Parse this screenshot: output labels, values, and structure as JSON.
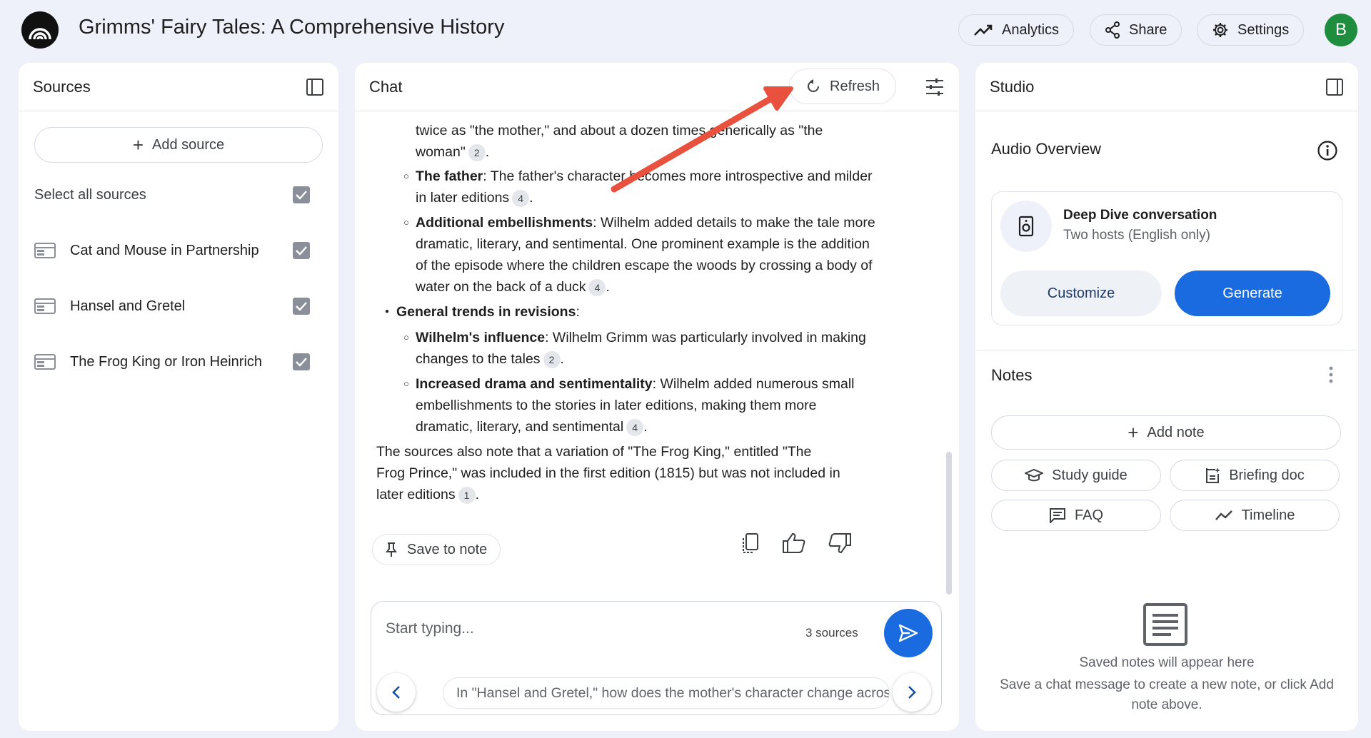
{
  "header": {
    "title": "Grimms' Fairy Tales: A Comprehensive History",
    "analytics_label": "Analytics",
    "share_label": "Share",
    "settings_label": "Settings",
    "avatar_initial": "B"
  },
  "sources": {
    "title": "Sources",
    "add_source_label": "Add source",
    "select_all_label": "Select all sources",
    "items": [
      {
        "label": "Cat and Mouse in Partnership",
        "checked": true
      },
      {
        "label": "Hansel and Gretel",
        "checked": true
      },
      {
        "label": "The Frog King or Iron Heinrich",
        "checked": true
      }
    ]
  },
  "chat": {
    "title": "Chat",
    "refresh_label": "Refresh",
    "intro_text": "twice as \"the mother,\" and about a dozen times generically as \"the woman\"",
    "intro_cite": "2",
    "items": [
      {
        "bold": "The father",
        "text": ": The father's character becomes more introspective and milder in later editions",
        "cite": "4"
      },
      {
        "bold": "Additional embellishments",
        "text": ": Wilhelm added details to make the tale more dramatic, literary, and sentimental. One prominent example is the addition of the episode where the children escape the woods by crossing a body of water on the back of a duck",
        "cite": "4"
      }
    ],
    "bullet_heading": "General trends in revisions",
    "bullet_items": [
      {
        "bold": "Wilhelm's influence",
        "text": ": Wilhelm Grimm was particularly involved in making changes to the tales",
        "cite": "2"
      },
      {
        "bold": "Increased drama and sentimentality",
        "text": ": Wilhelm added numerous small embellishments to the stories in later editions, making them more dramatic, literary, and sentimental",
        "cite": "4"
      }
    ],
    "closing_text": "The sources also note that a variation of \"The Frog King,\" entitled \"The Frog Prince,\" was included in the first edition (1815) but was not included in later editions",
    "closing_cite": "1",
    "save_note_label": "Save to note",
    "input_placeholder": "Start typing...",
    "source_count": "3 sources",
    "suggestion": "In \"Hansel and Gretel,\" how does the mother's character change across editions?"
  },
  "studio": {
    "title": "Studio",
    "audio_overview_label": "Audio Overview",
    "deep_dive_title": "Deep Dive conversation",
    "deep_dive_subtitle": "Two hosts (English only)",
    "customize_label": "Customize",
    "generate_label": "Generate",
    "notes_label": "Notes",
    "add_note_label": "Add note",
    "study_guide_label": "Study guide",
    "briefing_doc_label": "Briefing doc",
    "faq_label": "FAQ",
    "timeline_label": "Timeline",
    "empty_title": "Saved notes will appear here",
    "empty_body": "Save a chat message to create a new note, or click Add note above."
  },
  "colors": {
    "accent": "#1a6be0",
    "avatar": "#1e8e3e",
    "annotation_arrow": "#e8513d"
  }
}
